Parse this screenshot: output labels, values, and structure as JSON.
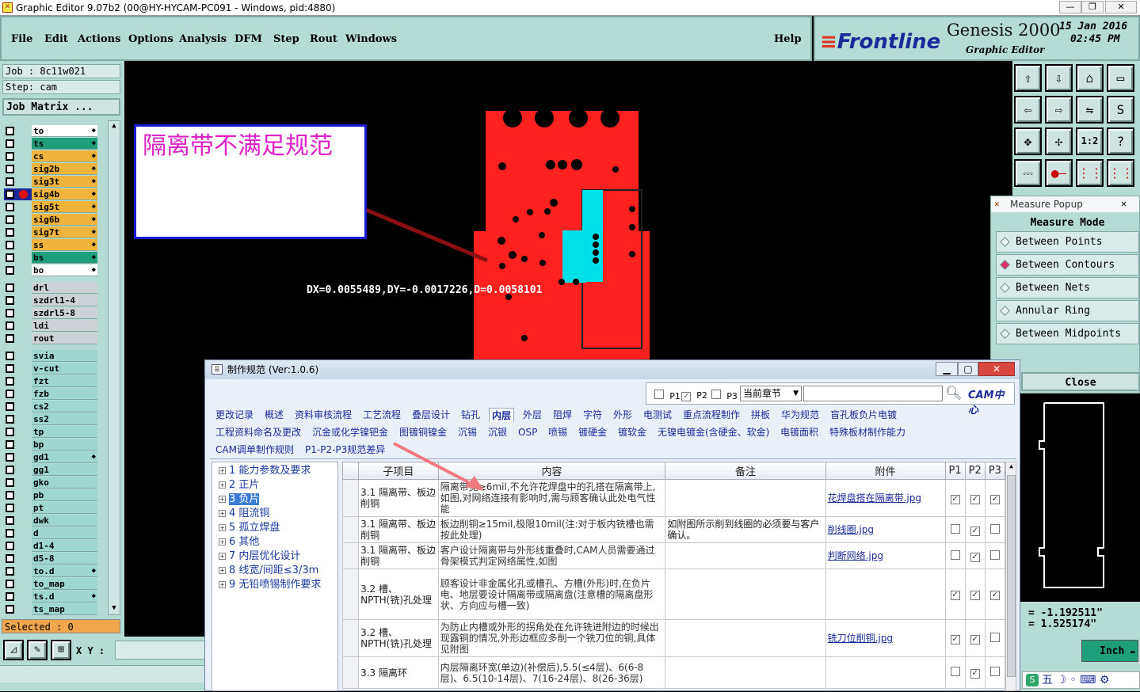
{
  "window": {
    "title": "Graphic Editor 9.07b2 (00@HY-HYCAM-PC091 - Windows, pid:4880)",
    "min": "—",
    "max": "❐",
    "close": "✕"
  },
  "menu": [
    "File",
    "Edit",
    "Actions",
    "Options",
    "Analysis",
    "DFM",
    "Step",
    "Rout",
    "Windows"
  ],
  "help": "Help",
  "brand": {
    "logo": "Frontline",
    "product": "Genesis 2000",
    "subtitle": "Graphic Editor",
    "date": "15 Jan 2016",
    "time": "02:45 PM"
  },
  "job": {
    "job": "Job : 8c11w021",
    "step": "Step: cam",
    "matrix": "Job Matrix ..."
  },
  "layers1": [
    {
      "name": "to",
      "color": "#ffffff"
    },
    {
      "name": "ts",
      "color": "#1f9e7a"
    },
    {
      "name": "cs",
      "color": "#f0b43c"
    },
    {
      "name": "sig2b",
      "color": "#f0b43c"
    },
    {
      "name": "sig3t",
      "color": "#f0b43c"
    },
    {
      "name": "sig4b",
      "color": "#f0b43c"
    },
    {
      "name": "sig5t",
      "color": "#f0b43c"
    },
    {
      "name": "sig6b",
      "color": "#f0b43c"
    },
    {
      "name": "sig7t",
      "color": "#f0b43c"
    },
    {
      "name": "ss",
      "color": "#f0b43c"
    },
    {
      "name": "bs",
      "color": "#1f9e7a"
    },
    {
      "name": "bo",
      "color": "#ffffff"
    }
  ],
  "layers2": [
    "drl",
    "szdrl1-4",
    "szdrl5-8",
    "ldi",
    "rout"
  ],
  "layers3": [
    "svia",
    "v-cut",
    "fzt",
    "fzb",
    "cs2",
    "ss2",
    "tp",
    "bp",
    "gd1",
    "gg1",
    "gko",
    "pb",
    "pt",
    "dwk",
    "d",
    "d1-4",
    "d5-8",
    "to.d",
    "to_map",
    "ts.d",
    "ts_map"
  ],
  "selected": "Selected : 0",
  "xy_label": "X Y :",
  "annotation": "隔离带不满足规范",
  "measure_readout": "DX=0.0055489,DY=-0.0017226,D=0.0058101",
  "measure_popup": {
    "title": "Measure Popup",
    "mode": "Measure Mode",
    "options": [
      "Between Points",
      "Between Contours",
      "Between Nets",
      "Annular Ring",
      "Between Midpoints"
    ],
    "selected_index": 1,
    "close": "Close"
  },
  "coords": {
    "x": "= -1.192511\"",
    "y": "=  1.525174\""
  },
  "unit": "Inch",
  "ime": "五",
  "dialog": {
    "title": "制作规范 (Ver:1.0.6)",
    "filters": {
      "p1": "P1",
      "p2": "P2",
      "p3": "P3",
      "chapter": "当前章节"
    },
    "logo": "CAM中心",
    "tabs_row1": [
      "更改记录",
      "概述",
      "资料审核流程",
      "工艺流程",
      "叠层设计",
      "钻孔",
      "内层",
      "外层",
      "阻焊",
      "字符",
      "外形",
      "电测试",
      "重点流程制作",
      "拼板",
      "华为规范",
      "盲孔板负片电镀"
    ],
    "tabs_row2": [
      "工程资料命名及更改",
      "沉金或化学镍钯金",
      "图镀铜镍金",
      "沉锡",
      "沉银",
      "OSP",
      "喷锡",
      "镀硬金",
      "镀软金",
      "无镍电镀金(含硬金、软金)",
      "电镀面积",
      "特殊板材制作能力"
    ],
    "tabs_row3": [
      "CAM调单制作规则",
      "P1-P2-P3规范差异"
    ],
    "active_tab": "内层",
    "tree": [
      "1 能力参数及要求",
      "2 正片",
      "3 负片",
      "4 阻流铜",
      "5 孤立焊盘",
      "6 其他",
      "7 内层优化设计",
      "8 线宽/间距≤3/3m",
      "9 无铅喷锡制作要求"
    ],
    "tree_selected": 2,
    "columns": [
      "子项目",
      "内容",
      "备注",
      "附件",
      "P1",
      "P2",
      "P3"
    ],
    "rows": [
      {
        "item": "3.1 隔离带、板边削铜",
        "content": "隔离带宽≥6mil,不允许花焊盘中的孔搭在隔离带上,如图,对网络连接有影响时,需与顾客确认此处电气性能",
        "note": "",
        "attach": "花焊盘搭在隔离带.jpg",
        "p": [
          true,
          true,
          true
        ]
      },
      {
        "item": "3.1 隔离带、板边削铜",
        "content": "板边削铜≥15mil,极限10mil(注:对于板内铣槽也需按此处理)",
        "note": "如附图所示削到线圈的必须要与客户确认。",
        "attach": "削线圈.jpg",
        "p": [
          false,
          true,
          false
        ]
      },
      {
        "item": "3.1 隔离带、板边削铜",
        "content": "客户设计隔离带与外形线重叠时,CAM人员需要通过骨架模式判定网络属性,如图",
        "note": "",
        "attach": "判断网络.jpg",
        "p": [
          false,
          true,
          false
        ]
      },
      {
        "item": "3.2 槽、NPTH(铣)孔处理",
        "content": "顾客设计非金属化孔或槽孔、方槽(外形)时,在负片电、地层要设计隔离带或隔离盘(注意槽的隔离盘形状、方向应与槽一致)",
        "note": "",
        "attach": "",
        "p": [
          true,
          true,
          true
        ]
      },
      {
        "item": "3.2 槽、NPTH(铣)孔处理",
        "content": "为防止内槽或外形的拐角处在允许铣进附边的时候出现露铜的情况,外形边框应多削一个铣刀位的铜,具体见附图",
        "note": "",
        "attach": "铣刀位削铜.jpg",
        "p": [
          true,
          true,
          false
        ]
      },
      {
        "item": "3.3 隔离环",
        "content": "内层隔离环宽(单边)(补偿后),5.5(≤4层)、6(6-8层)、6.5(10-14层)、7(16-24层)、8(26-36层)",
        "note": "",
        "attach": "",
        "p": [
          false,
          true,
          false
        ]
      }
    ]
  }
}
